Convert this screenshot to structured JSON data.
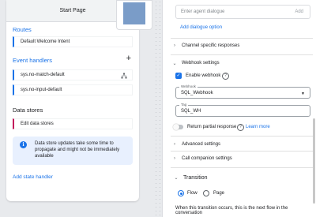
{
  "left_panel": {
    "header_title": "Start Page",
    "routes_title": "Routes",
    "routes": [
      "Default Welcome Intent"
    ],
    "event_handlers_title": "Event handlers",
    "add_icon": "+",
    "event_handlers": [
      "sys.no-match-default",
      "sys.no-input-default"
    ],
    "data_stores_title": "Data stores",
    "data_stores": [
      "Edit data stores"
    ],
    "info_message": "Data store updates take some time to propagate and might not be immediately available",
    "add_state_handler": "Add state handler"
  },
  "right_panel": {
    "agent_dialogue_placeholder": "Enter agent dialogue",
    "agent_dialogue_add": "Add",
    "add_dialogue_option": "Add dialogue option",
    "channel_specific": "Channel specific responses",
    "webhook_settings": "Webhook settings",
    "enable_webhook": "Enable webhook",
    "webhook_field_label": "Webhook",
    "webhook_value": "SQL_Webhook",
    "tag_field_label": "Tag",
    "tag_value": "SQL_WH",
    "return_partial": "Return partial response",
    "learn_more": "Learn more",
    "advanced_settings": "Advanced settings",
    "call_companion": "Call companion settings",
    "transition_title": "Transition",
    "flow_label": "Flow",
    "page_label": "Page",
    "footer_text": "When this transition occurs, this is the next flow in the conversation"
  },
  "icons": {
    "help": "?",
    "info": "i",
    "chevron_right": "›",
    "chevron_down": "⌄",
    "check": "✓",
    "dropdown": "▼"
  },
  "colors": {
    "accent": "#1a73e8",
    "pink_marker": "#c2185b",
    "info_bg": "#e8f0fe"
  }
}
